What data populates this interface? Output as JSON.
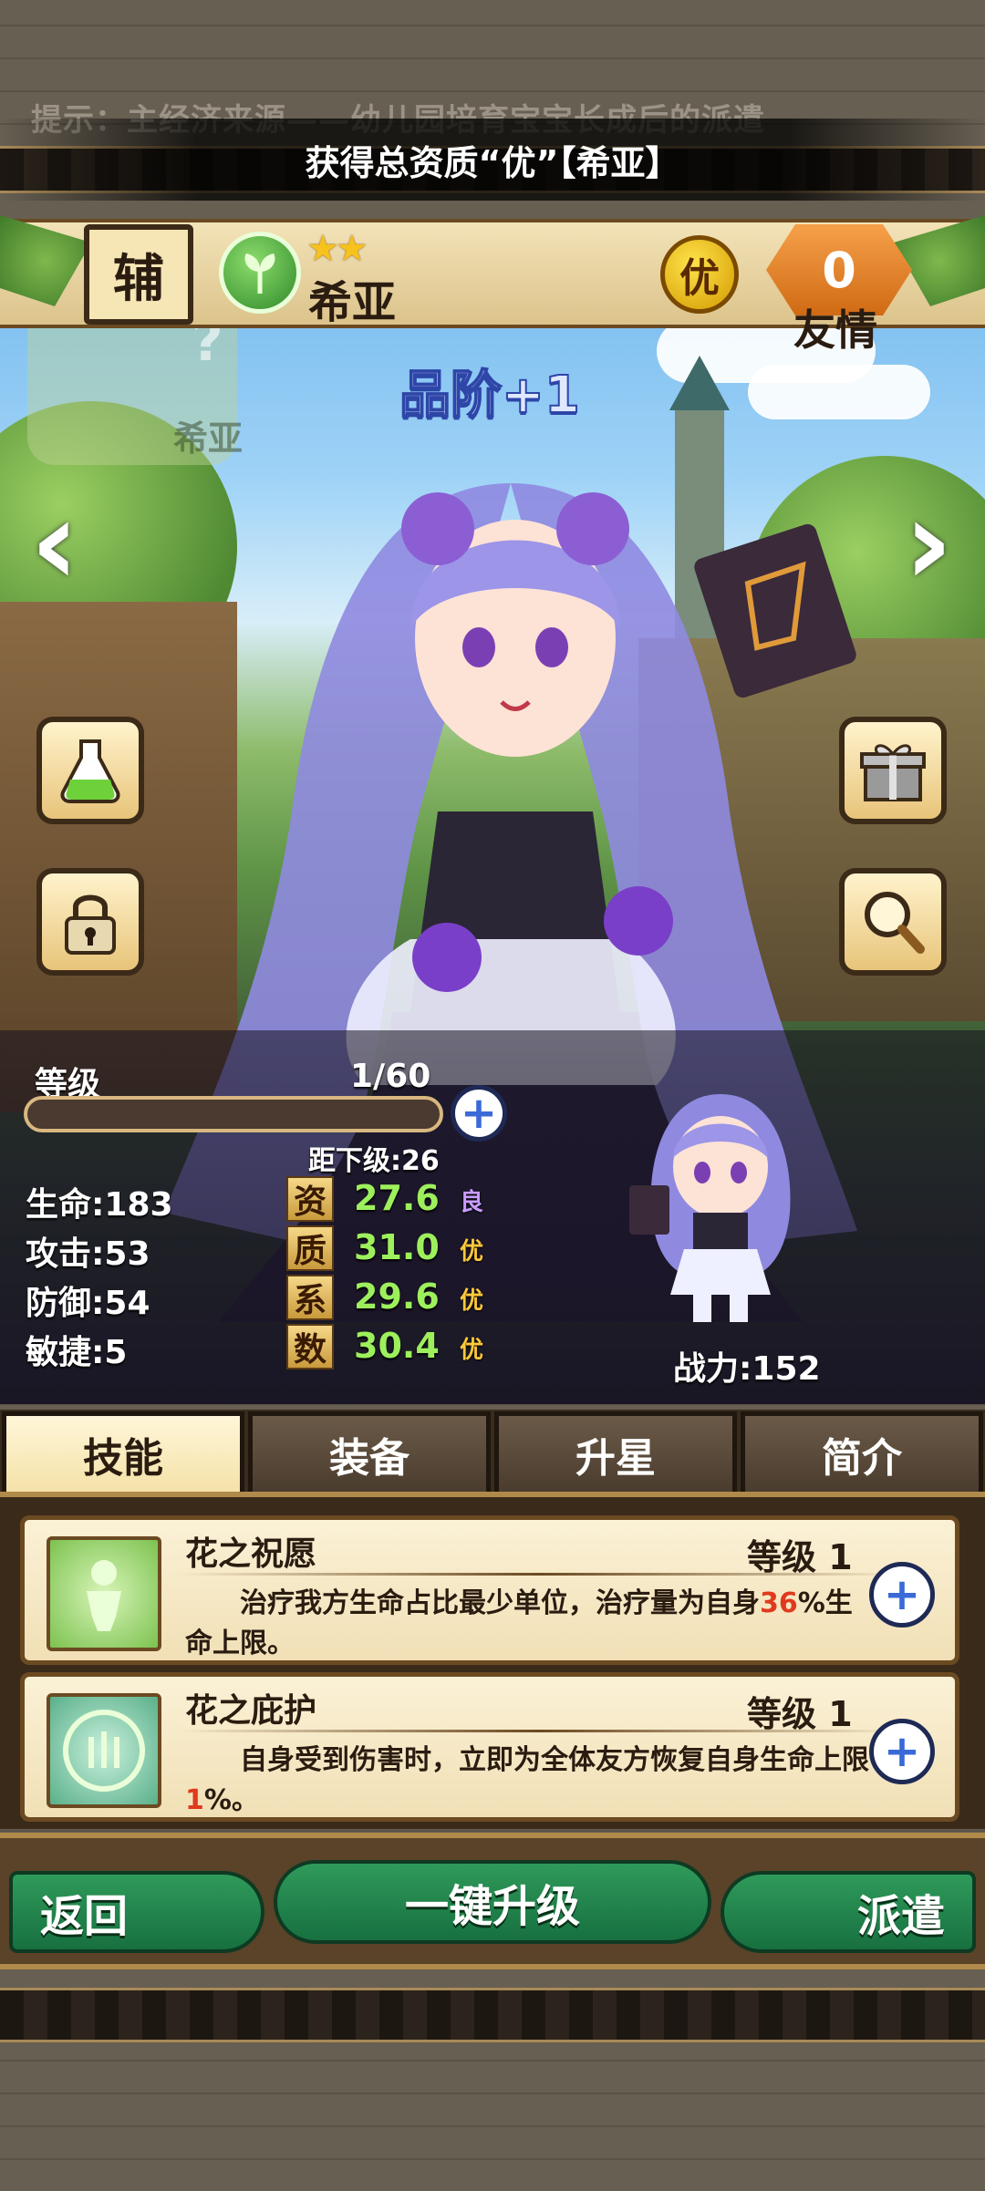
{
  "hint": "提示：主经济来源——幼儿园培育宝宝长成后的派遣",
  "toast": "获得总资质“优”【希亚】",
  "header": {
    "role": "辅",
    "stars": "★★",
    "name": "希亚",
    "quality": "优",
    "friendship_value": "0",
    "friendship_label": "友情"
  },
  "ghost_name": "希亚",
  "rank_up": "品阶+1",
  "level": {
    "label": "等级",
    "value": "1/60",
    "next_label": "距下级:26",
    "progress": 0.0
  },
  "stats": [
    {
      "label": "生命:183"
    },
    {
      "label": "攻击:53"
    },
    {
      "label": "防御:54"
    },
    {
      "label": "敏捷:5"
    }
  ],
  "aptitude": [
    {
      "char": "资",
      "value": "27.6",
      "grade": "良",
      "grade_color": "#c99cff"
    },
    {
      "char": "质",
      "value": "31.0",
      "grade": "优",
      "grade_color": "#ffc83a"
    },
    {
      "char": "系",
      "value": "29.6",
      "grade": "优",
      "grade_color": "#ffc83a"
    },
    {
      "char": "数",
      "value": "30.4",
      "grade": "优",
      "grade_color": "#ffc83a"
    }
  ],
  "power": "战力:152",
  "tabs": [
    "技能",
    "装备",
    "升星",
    "简介"
  ],
  "skills": [
    {
      "name": "花之祝愿",
      "level": "等级 1",
      "desc_a": "治疗我方生命占比最少单位，治疗量为自身",
      "desc_hl": "36",
      "desc_b": "%生命上限。"
    },
    {
      "name": "花之庇护",
      "level": "等级 1",
      "desc_a": "自身受到伤害时，立即为全体友方恢复自身生命上限",
      "desc_hl": "1",
      "desc_b": "%。"
    }
  ],
  "bottom": {
    "back": "返回",
    "upgrade_all": "一键升级",
    "dispatch": "派遣"
  },
  "colors": {
    "accent_green": "#177040",
    "highlight_red": "#e03a1e",
    "frame_brown": "#6b4a22"
  }
}
